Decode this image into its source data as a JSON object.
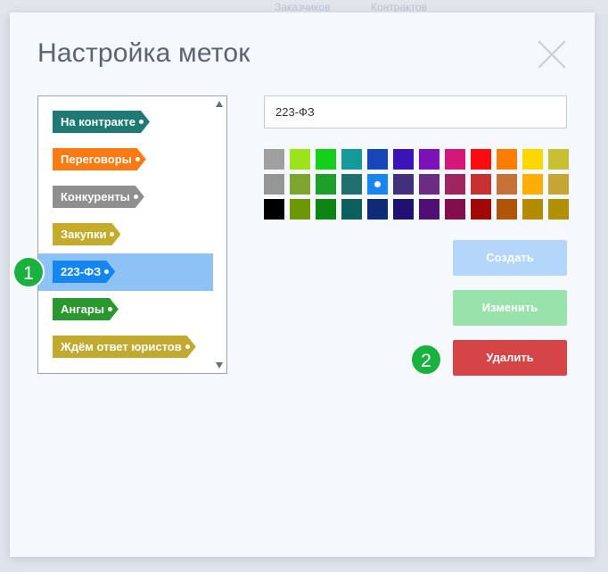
{
  "background": {
    "nav": [
      "Заказчиков",
      "Контрактов"
    ]
  },
  "modal": {
    "title": "Настройка меток",
    "close_icon": "close-icon"
  },
  "tags": [
    {
      "label": "На контракте",
      "color": "#1f7a74"
    },
    {
      "label": "Переговоры",
      "color": "#fb7a12"
    },
    {
      "label": "Конкуренты",
      "color": "#8f8f8f"
    },
    {
      "label": "Закупки",
      "color": "#c4ab2a"
    },
    {
      "label": "223-ФЗ",
      "color": "#1386ef",
      "selected": true
    },
    {
      "label": "Ангары",
      "color": "#29992f"
    },
    {
      "label": "Ждём ответ юристов",
      "color": "#c2a92f"
    }
  ],
  "form": {
    "name_value": "223-ФЗ"
  },
  "palette": [
    [
      "#a0a0a0",
      "#9be31b",
      "#14d01a",
      "#159a9a",
      "#1845b7",
      "#3a14b9",
      "#7a11b9",
      "#d6177a",
      "#fc0c11",
      "#fb7d05",
      "#fcd802",
      "#c6c032"
    ],
    [
      "#969696",
      "#7fa531",
      "#1e9f2c",
      "#20706f",
      "#1886ee",
      "#43307c",
      "#6b2d83",
      "#9f2561",
      "#c63232",
      "#c47237",
      "#fbae05",
      "#c4a535"
    ],
    [
      "#000000",
      "#6c9806",
      "#0e8412",
      "#0b605e",
      "#0f2a76",
      "#201170",
      "#4f0f73",
      "#820e4c",
      "#a10707",
      "#ae5507",
      "#b38b00",
      "#af9006"
    ]
  ],
  "palette_selected": {
    "row": 1,
    "col": 4
  },
  "buttons": {
    "create": "Создать",
    "edit": "Изменить",
    "delete": "Удалить"
  },
  "annotations": {
    "badge1": "1",
    "badge2": "2",
    "color": "#19b23e"
  }
}
